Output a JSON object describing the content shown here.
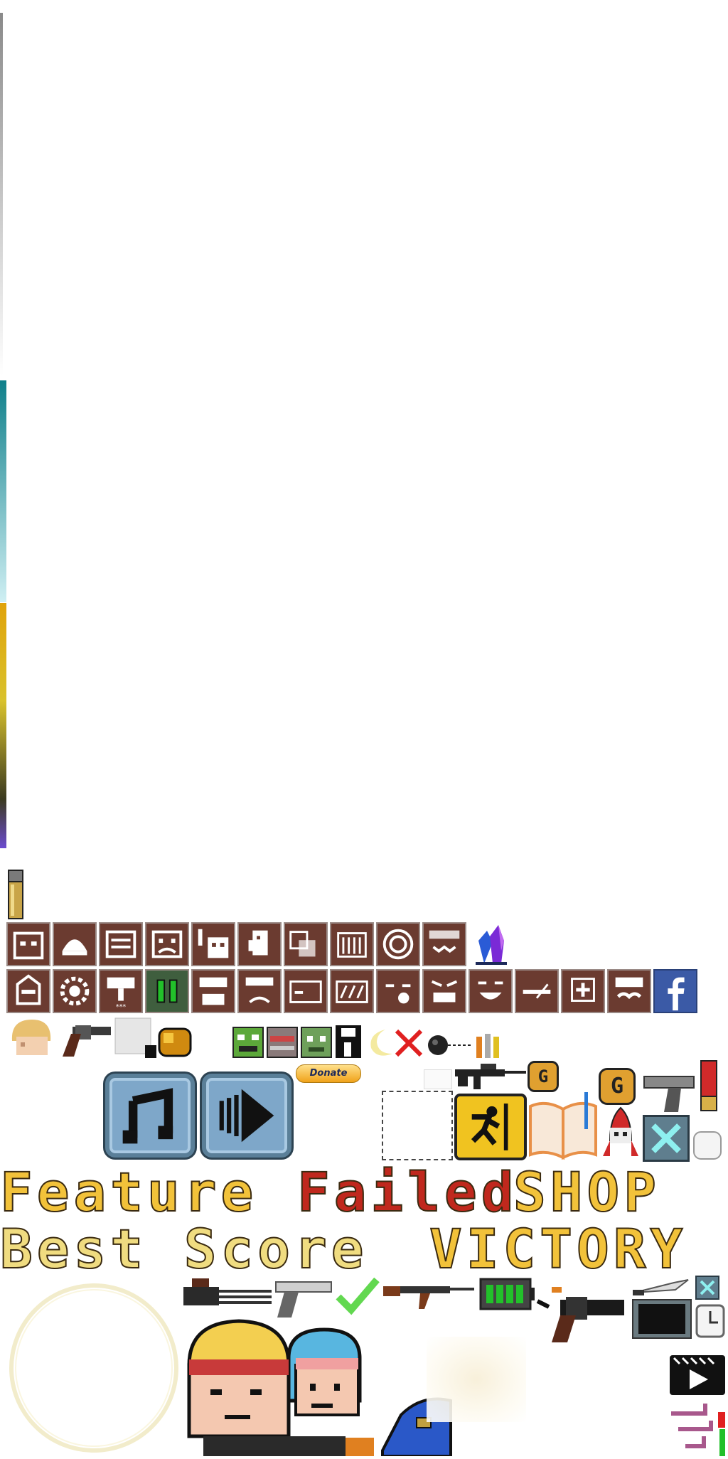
{
  "atlas": {
    "buttons": {
      "donate_label": "Donate"
    },
    "titles": {
      "feature": "Feature",
      "failed": "Failed",
      "shop": "SHOP",
      "best_score": "Best Score",
      "victory": "VICTORY"
    },
    "badges": {
      "gold_g_1": "G",
      "gold_g_2": "G"
    },
    "icons_row1": [
      "face-icon",
      "helmet-icon",
      "mask-icon",
      "sad-face-icon",
      "skull-icon",
      "ghost-icon",
      "cube-icon",
      "teeth-icon",
      "target-icon",
      "grin-icon",
      "crystal-icon"
    ],
    "icons_row2": [
      "ninja-icon",
      "gear-icon",
      "shield-icon",
      "pause-icon",
      "beard-icon",
      "frown-icon",
      "box-icon",
      "stripe-icon",
      "wink-icon",
      "grumpy-icon",
      "smile-icon",
      "blade-icon",
      "medic-icon",
      "mustache-icon",
      "facebook-icon"
    ],
    "colors": {
      "tile": "#6b3b30",
      "title_gold": "#f2c23a",
      "title_red": "#c0281d",
      "button_blue": "#7ea7c9"
    }
  }
}
